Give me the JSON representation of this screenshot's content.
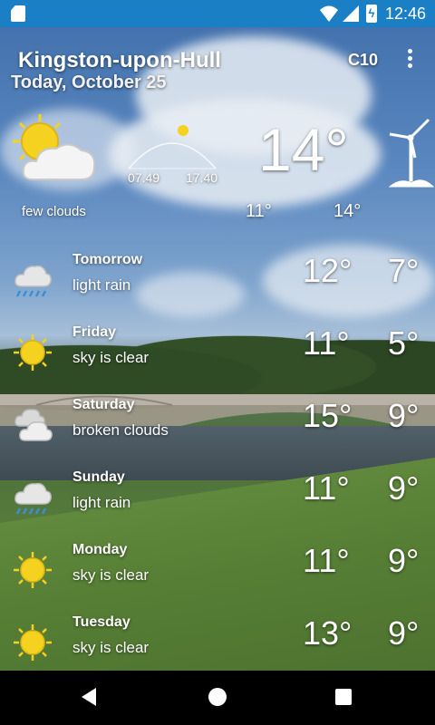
{
  "status": {
    "time": "12:46"
  },
  "header": {
    "city": "Kingston-upon-Hull",
    "date": "Today, October 25",
    "unit_button": "C10"
  },
  "today": {
    "description": "few clouds",
    "icon": "partly-cloudy-icon",
    "sunrise": "07.49",
    "sunset": "17.40",
    "current_temp": "14°",
    "min_temp": "11°",
    "max_temp": "14°"
  },
  "forecast": [
    {
      "day": "Tomorrow",
      "desc": "light rain",
      "icon": "rain-cloud-icon",
      "high": "12°",
      "low": "7°"
    },
    {
      "day": "Friday",
      "desc": "sky is clear",
      "icon": "sun-icon",
      "high": "11°",
      "low": "5°"
    },
    {
      "day": "Saturday",
      "desc": "broken clouds",
      "icon": "clouds-icon",
      "high": "15°",
      "low": "9°"
    },
    {
      "day": "Sunday",
      "desc": "light rain",
      "icon": "rain-cloud-icon",
      "high": "11°",
      "low": "9°"
    },
    {
      "day": "Monday",
      "desc": "sky is clear",
      "icon": "sun-icon",
      "high": "11°",
      "low": "9°"
    },
    {
      "day": "Tuesday",
      "desc": "sky is clear",
      "icon": "sun-icon",
      "high": "13°",
      "low": "9°"
    }
  ],
  "colors": {
    "status_bar": "#1a7fc4",
    "sun": "#f4d21f",
    "rain": "#3a8fd8"
  }
}
